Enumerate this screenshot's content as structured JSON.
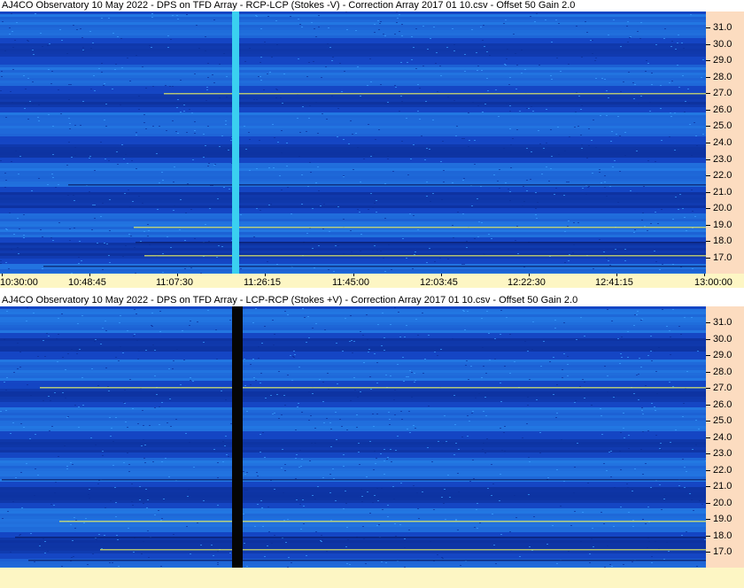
{
  "panels": [
    {
      "title": "AJ4CO Observatory 10 May 2022  -  DPS on TFD Array  -  RCP-LCP (Stokes -V)  -  Correction Array 2017 01 10.csv  -  Offset 50  Gain 2.0",
      "polarization": "RCP-LCP",
      "frequency_ticks": [
        "31.0",
        "30.0",
        "29.0",
        "28.0",
        "27.0",
        "26.0",
        "25.0",
        "24.0",
        "23.0",
        "22.0",
        "21.0",
        "20.0",
        "19.0",
        "18.0",
        "17.0"
      ]
    },
    {
      "title": "AJ4CO Observatory 10 May 2022  -  DPS on TFD Array  -  LCP-RCP (Stokes +V)  -  Correction Array 2017 01 10.csv  -  Offset 50  Gain 2.0",
      "polarization": "LCP-RCP",
      "frequency_ticks": [
        "31.0",
        "30.0",
        "29.0",
        "28.0",
        "27.0",
        "26.0",
        "25.0",
        "24.0",
        "23.0",
        "22.0",
        "21.0",
        "20.0",
        "19.0",
        "18.0",
        "17.0"
      ]
    }
  ],
  "time_ticks": [
    "10:30:00",
    "10:48:45",
    "11:07:30",
    "11:26:15",
    "11:45:00",
    "12:03:45",
    "12:22:30",
    "12:41:15",
    "13:00:00"
  ],
  "colors": {
    "background_blue": "#1546c4",
    "freq_axis_bg": "#fcdcc0",
    "time_axis_bg": "#fdf6c4",
    "stripe_light": "#2a8ff0",
    "stripe_dark": "#0a2a90",
    "highlight_yellow": "#e8f060",
    "column_black": "#050505",
    "column_cyan": "#3ad0f0"
  }
}
